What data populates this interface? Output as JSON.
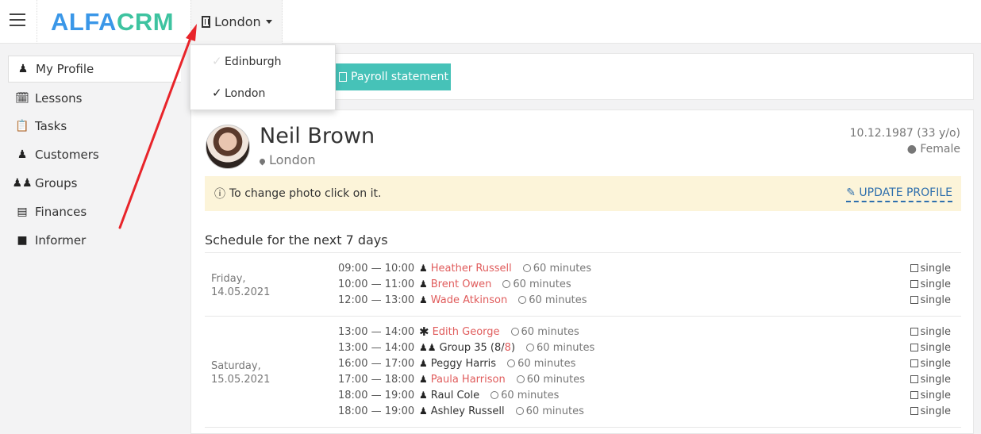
{
  "brand": {
    "part1": "ALFA",
    "part2": "CRM"
  },
  "branch_selector": {
    "label": "London"
  },
  "dropdown": {
    "items": [
      {
        "label": "Edinburgh",
        "checked": false
      },
      {
        "label": "London",
        "checked": true
      }
    ]
  },
  "sidebar": {
    "items": [
      {
        "label": "My Profile",
        "icon": "user-icon",
        "active": true
      },
      {
        "label": "Lessons",
        "icon": "calendar-icon"
      },
      {
        "label": "Tasks",
        "icon": "clipboard-icon"
      },
      {
        "label": "Customers",
        "icon": "user-icon"
      },
      {
        "label": "Groups",
        "icon": "users-icon"
      },
      {
        "label": "Finances",
        "icon": "money-icon"
      },
      {
        "label": "Informer",
        "icon": "book-icon"
      }
    ]
  },
  "toolbar": {
    "payroll_label": "Payroll statement"
  },
  "profile": {
    "name": "Neil Brown",
    "location": "London",
    "dob": "10.12.1987 (33 y/o)",
    "gender": "Female",
    "notice": "To change photo click on it.",
    "update_label": "UPDATE PROFILE"
  },
  "schedule": {
    "title": "Schedule for the next 7 days",
    "days": [
      {
        "day_name": "Friday,",
        "date": "14.05.2021",
        "lessons": [
          {
            "time": "09:00 — 10:00",
            "who": "Heather Russell",
            "duration": "60 minutes",
            "type": "single"
          },
          {
            "time": "10:00 — 11:00",
            "who": "Brent Owen",
            "duration": "60 minutes",
            "type": "single"
          },
          {
            "time": "12:00 — 13:00",
            "who": "Wade Atkinson",
            "duration": "60 minutes",
            "type": "single"
          }
        ]
      },
      {
        "day_name": "Saturday,",
        "date": "15.05.2021",
        "lessons": [
          {
            "time": "13:00 — 14:00",
            "who": "Edith George",
            "duration": "60 minutes",
            "type": "single"
          },
          {
            "time": "13:00 — 14:00",
            "who": "Group 35 (",
            "count_a": "8",
            "slash": "/",
            "count_b": "8",
            "close": ")",
            "duration": "60 minutes",
            "type": "single"
          },
          {
            "time": "16:00 — 17:00",
            "who": "Peggy Harris",
            "duration": "60 minutes",
            "type": "single"
          },
          {
            "time": "17:00 — 18:00",
            "who": "Paula Harrison",
            "duration": "60 minutes",
            "type": "single"
          },
          {
            "time": "18:00 — 19:00",
            "who": "Raul Cole",
            "duration": "60 minutes",
            "type": "single"
          },
          {
            "time": "18:00 — 19:00",
            "who": "Ashley Russell",
            "duration": "60 minutes",
            "type": "single"
          }
        ]
      }
    ]
  },
  "colors": {
    "brand_blue": "#3a97e8",
    "brand_green": "#3ec3a0",
    "accent_teal": "#46c2b8",
    "link_red": "#e05c5c",
    "arrow_red": "#e8242a"
  }
}
